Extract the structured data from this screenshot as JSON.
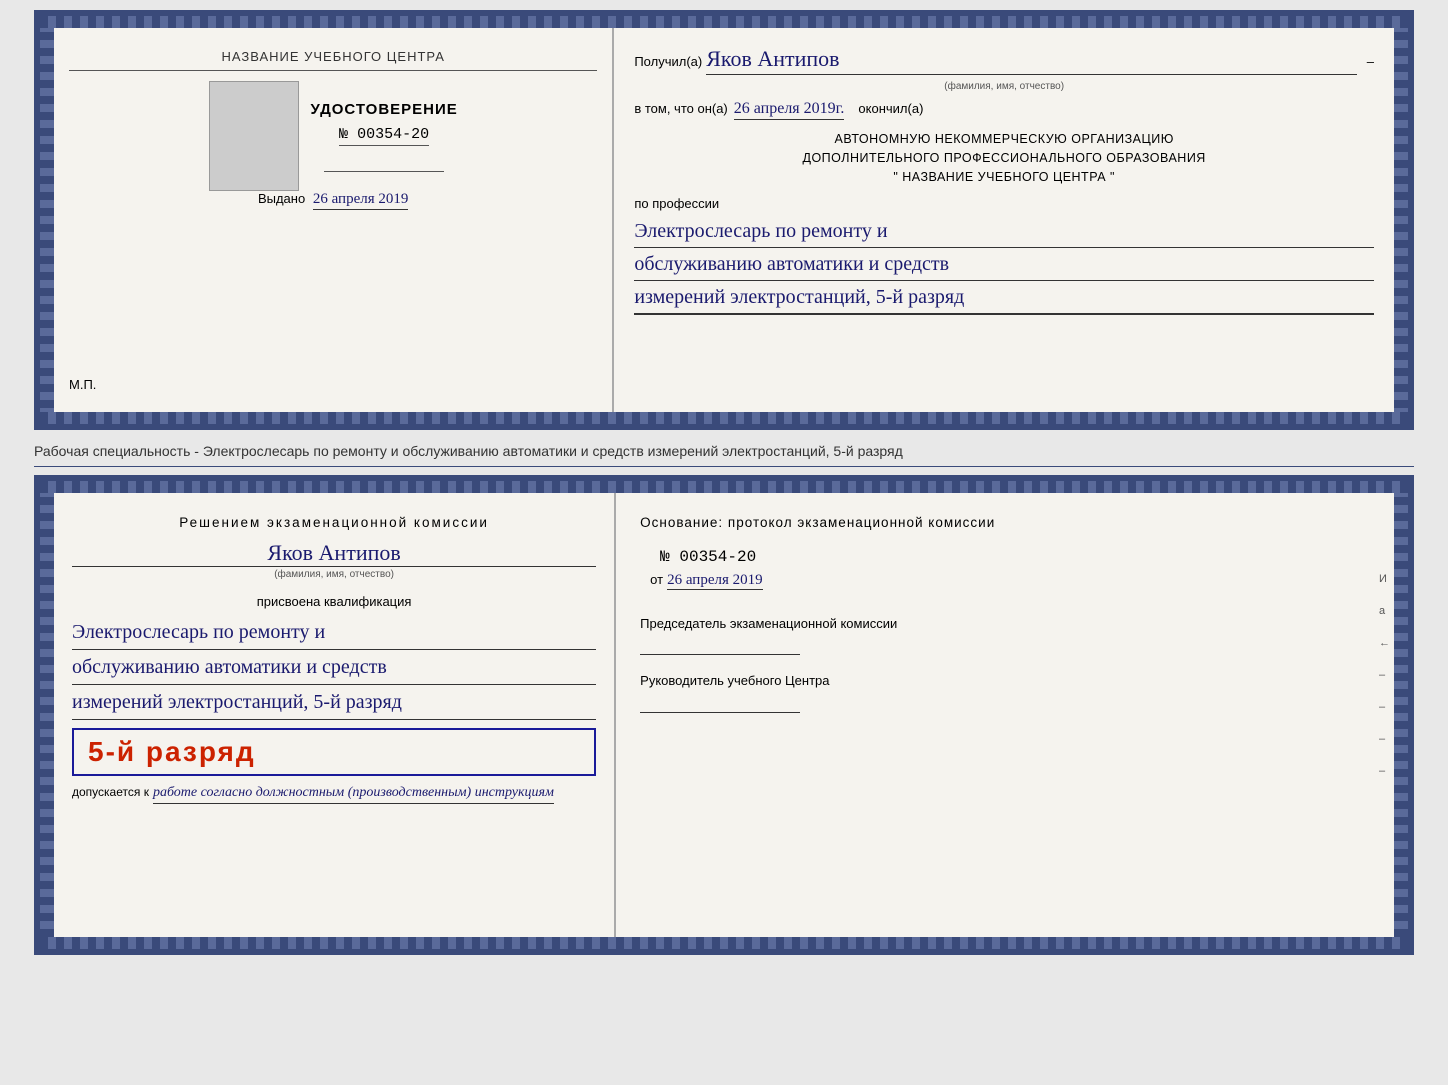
{
  "top_doc": {
    "left": {
      "school_name": "НАЗВАНИЕ УЧЕБНОГО ЦЕНТРА",
      "cert_title": "УДОСТОВЕРЕНИЕ",
      "cert_number": "№ 00354-20",
      "issued_label": "Выдано",
      "issued_date": "26 апреля 2019",
      "mp_label": "М.П."
    },
    "right": {
      "poluchil_label": "Получил(а)",
      "recipient_name": "Яков Антипов",
      "fio_sublabel": "(фамилия, имя, отчество)",
      "vtom_label": "в том, что он(а)",
      "completion_date": "26 апреля 2019г.",
      "okonchil_label": "окончил(а)",
      "org_line1": "АВТОНОМНУЮ НЕКОММЕРЧЕСКУЮ ОРГАНИЗАЦИЮ",
      "org_line2": "ДОПОЛНИТЕЛЬНОГО ПРОФЕССИОНАЛЬНОГО ОБРАЗОВАНИЯ",
      "org_line3": "\"  НАЗВАНИЕ УЧЕБНОГО ЦЕНТРА  \"",
      "po_professii_label": "по профессии",
      "profession_line1": "Электрослесарь по ремонту и",
      "profession_line2": "обслуживанию автоматики и средств",
      "profession_line3": "измерений электростанций, 5-й разряд"
    }
  },
  "separator": {
    "text": "Рабочая специальность - Электрослесарь по ремонту и обслуживанию автоматики и средств измерений электростанций, 5-й разряд"
  },
  "bottom_doc": {
    "left": {
      "decision_text": "Решением экзаменационной комиссии",
      "assigned_name": "Яков Антипов",
      "fio_sublabel": "(фамилия, имя, отчество)",
      "prisvoyena_label": "присвоена квалификация",
      "qualification_line1": "Электрослесарь по ремонту и",
      "qualification_line2": "обслуживанию автоматики и средств",
      "qualification_line3": "измерений электростанций, 5-й разряд",
      "rank_badge": "5-й разряд",
      "dopuskaetsya_label": "допускается к",
      "work_instructions": "работе согласно должностным (производственным) инструкциям"
    },
    "right": {
      "osnovaniye_label": "Основание: протокол экзаменационной комиссии",
      "protocol_number": "№  00354-20",
      "ot_label": "от",
      "protocol_date": "26 апреля 2019",
      "chairman_title": "Председатель экзаменационной комиссии",
      "rukovoditel_title": "Руководитель учебного Центра"
    },
    "right_letters": [
      "И",
      "а",
      "←",
      "–",
      "–",
      "–",
      "–"
    ]
  }
}
